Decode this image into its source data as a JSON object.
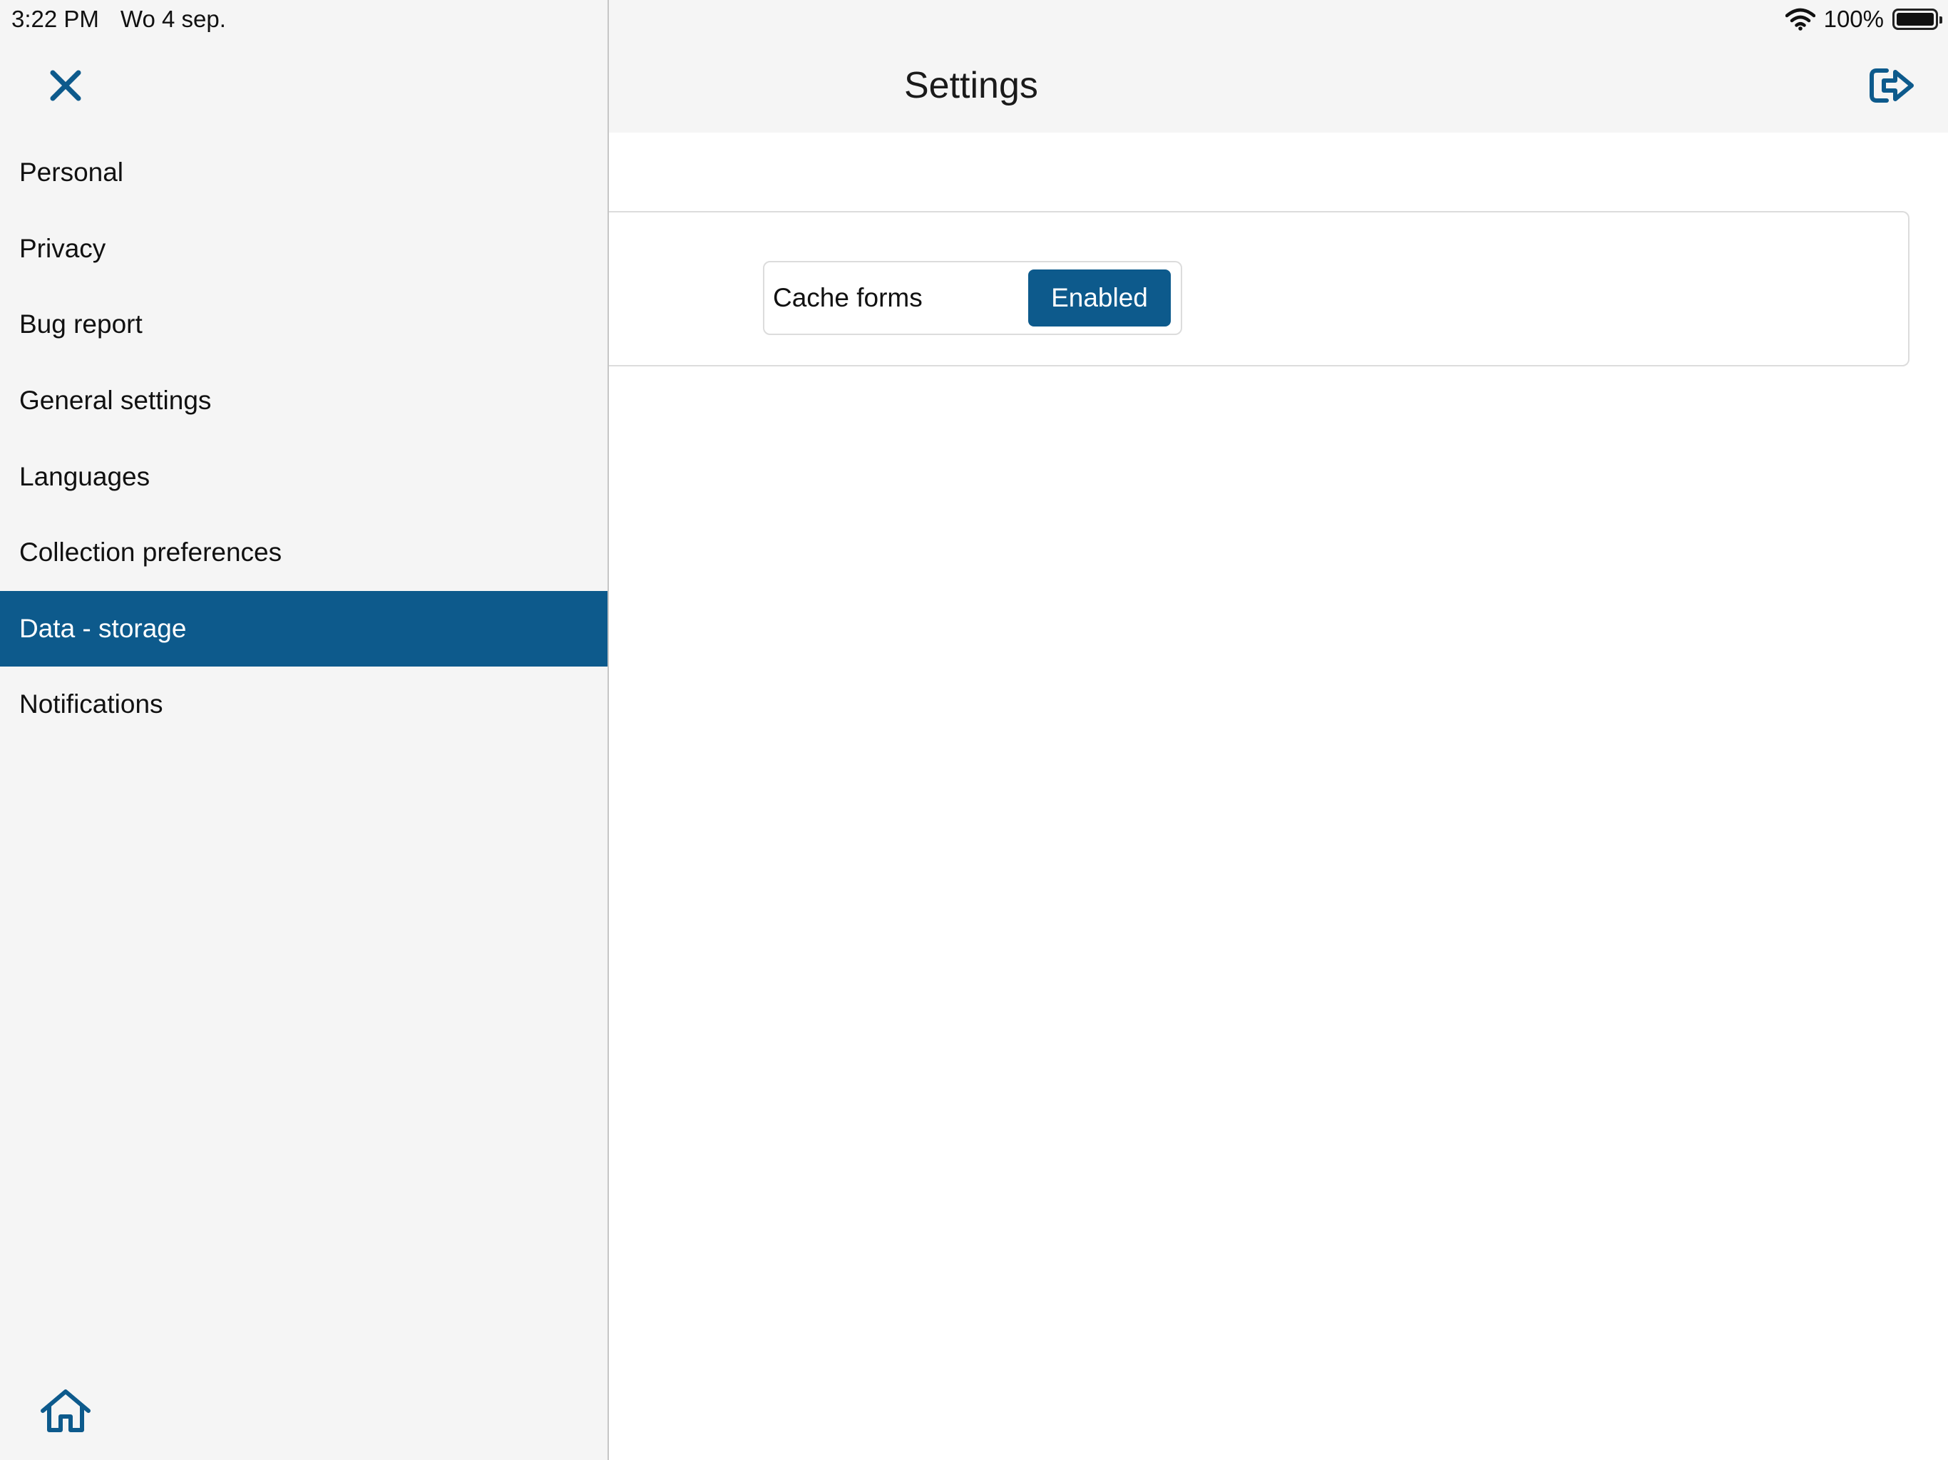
{
  "status_bar": {
    "time": "3:22 PM",
    "date": "Wo 4 sep.",
    "battery_percent": "100%",
    "battery_level": 1.0,
    "icons": [
      "wifi-icon",
      "battery-icon"
    ]
  },
  "header": {
    "title": "Settings",
    "icons": [
      "close-icon",
      "logout-icon"
    ]
  },
  "sidebar": {
    "items": [
      {
        "label": "Personal",
        "active": false
      },
      {
        "label": "Privacy",
        "active": false
      },
      {
        "label": "Bug report",
        "active": false
      },
      {
        "label": "General settings",
        "active": false
      },
      {
        "label": "Languages",
        "active": false
      },
      {
        "label": "Collection preferences",
        "active": false
      },
      {
        "label": "Data - storage",
        "active": true
      },
      {
        "label": "Notifications",
        "active": false
      }
    ],
    "footer_icon": "home-icon"
  },
  "content": {
    "settings": [
      {
        "label": "Cache forms",
        "value": "Enabled"
      }
    ]
  },
  "colors": {
    "accent": "#0d5a8c",
    "sidebar_bg": "#f5f5f5",
    "border": "#dcdcdc",
    "text": "#1a1a1a"
  }
}
